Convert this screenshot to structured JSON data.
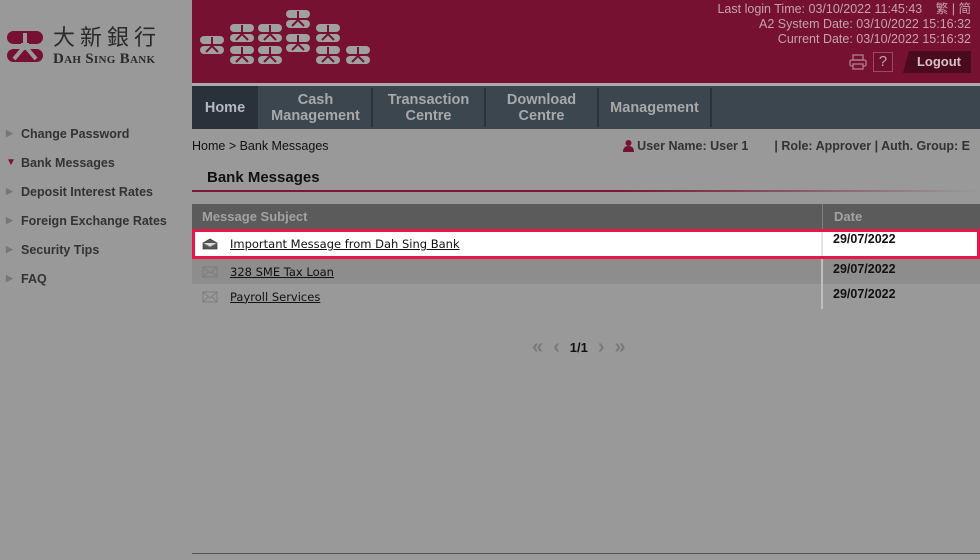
{
  "brand": {
    "name_cn": "大新銀行",
    "name_en": "Dah Sing Bank",
    "color": "#761131"
  },
  "header": {
    "last_login": "Last login Time: 03/10/2022 11:45:43",
    "lang_traditional": "繁",
    "lang_sep": "|",
    "lang_simplified": "简",
    "system_date": "A2 System Date: 03/10/2022 15:16:32",
    "current_date": "Current Date: 03/10/2022 15:16:32",
    "print_icon": "printer-icon",
    "help_label": "?",
    "logout_label": "Logout"
  },
  "nav": {
    "items": [
      {
        "line1": "Home",
        "line2": ""
      },
      {
        "line1": "Cash",
        "line2": "Management"
      },
      {
        "line1": "Transaction",
        "line2": "Centre"
      },
      {
        "line1": "Download",
        "line2": "Centre"
      },
      {
        "line1": "Management",
        "line2": ""
      }
    ],
    "active": "Home"
  },
  "sidebar": {
    "items": [
      {
        "label": "Change Password",
        "expanded": false
      },
      {
        "label": "Bank Messages",
        "expanded": true
      },
      {
        "label": "Deposit Interest Rates",
        "expanded": false
      },
      {
        "label": "Foreign Exchange Rates",
        "expanded": false
      },
      {
        "label": "Security Tips",
        "expanded": false
      },
      {
        "label": "FAQ",
        "expanded": false
      }
    ]
  },
  "breadcrumb": "Home > Bank Messages",
  "user": {
    "name": "User Name: User 1",
    "role_group": "| Role: Approver | Auth. Group: E"
  },
  "page": {
    "title": "Bank Messages"
  },
  "messages": {
    "columns": [
      "Message Subject",
      "Date"
    ],
    "rows": [
      {
        "subject": "Important Message from Dah Sing Bank",
        "date": "29/07/2022",
        "read": true,
        "highlighted": true
      },
      {
        "subject": "328 SME Tax Loan",
        "date": "29/07/2022",
        "read": false,
        "highlighted": false
      },
      {
        "subject": "Payroll Services",
        "date": "29/07/2022",
        "read": false,
        "highlighted": false
      }
    ]
  },
  "pagination": {
    "first": "«",
    "prev": "‹",
    "page_text": "1/1",
    "next": "›",
    "last": "»"
  }
}
